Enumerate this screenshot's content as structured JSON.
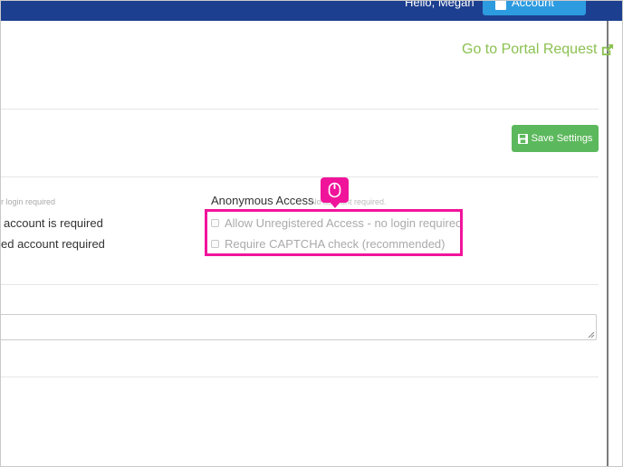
{
  "header": {
    "user_text": "Hello, Megan",
    "account_button": "Account"
  },
  "portal_link": "Go to Portal Request",
  "save_button": "Save Settings",
  "left_column": {
    "note": "r login required",
    "line1": "account is required",
    "line2": "ed account required"
  },
  "anonymous": {
    "title": "Anonymous Access",
    "note": "No account required.",
    "options": [
      {
        "label": "Allow Unregistered Access - no login required",
        "checked": false
      },
      {
        "label": "Require CAPTCHA check (recommended)",
        "checked": false
      }
    ]
  },
  "colors": {
    "header_bg": "#1d3f8f",
    "link": "#8cc152",
    "save_button": "#5cb85c",
    "highlight": "#f0149b"
  }
}
